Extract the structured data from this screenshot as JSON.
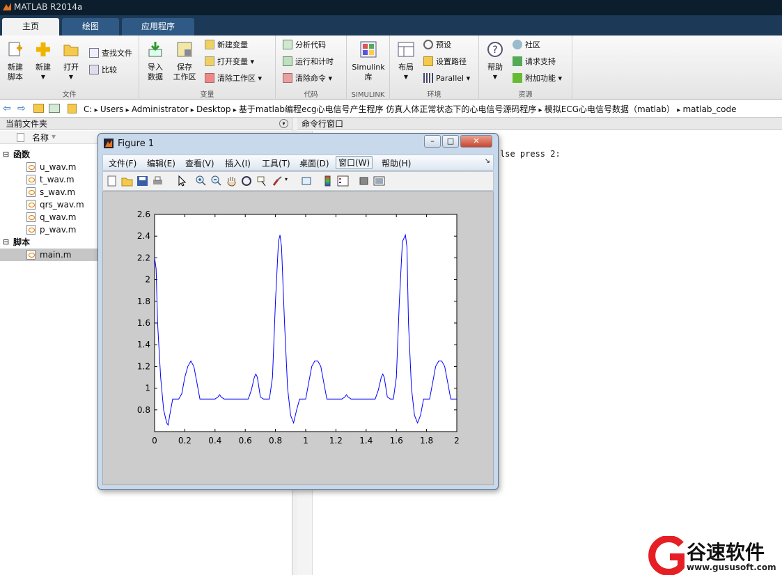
{
  "app": {
    "title": "MATLAB R2014a"
  },
  "tabs": [
    "主页",
    "绘图",
    "应用程序"
  ],
  "ribbon": {
    "file": {
      "label": "文件",
      "new_script": "新建\n脚本",
      "new": "新建",
      "open": "打开",
      "find_files": "查找文件",
      "compare": "比较"
    },
    "variable": {
      "label": "变量",
      "import": "导入\n数据",
      "save_ws": "保存\n工作区",
      "new_var": "新建变量",
      "open_var": "打开变量",
      "clear_ws": "清除工作区"
    },
    "code": {
      "label": "代码",
      "analyze": "分析代码",
      "run_time": "运行和计时",
      "clear_cmd": "清除命令"
    },
    "simulink": {
      "label": "SIMULINK",
      "lib": "Simulink\n库"
    },
    "env": {
      "label": "环境",
      "layout": "布局",
      "prefs": "预设",
      "set_path": "设置路径",
      "parallel": "Parallel"
    },
    "resources": {
      "label": "资源",
      "help": "帮助",
      "community": "社区",
      "request_support": "请求支持",
      "addons": "附加功能"
    }
  },
  "address": {
    "path": [
      "C:",
      "Users",
      "Administrator",
      "Desktop",
      "基于matlab编程ecg心电信号产生程序 仿真人体正常状态下的心电信号源码程序",
      "模拟ECG心电信号数据（matlab）",
      "matlab_code"
    ]
  },
  "current_folder": {
    "title": "当前文件夹",
    "column": "名称",
    "groups": [
      {
        "name": "函数",
        "files": [
          "u_wav.m",
          "t_wav.m",
          "s_wav.m",
          "qrs_wav.m",
          "q_wav.m",
          "p_wav.m"
        ]
      },
      {
        "name": "脚本",
        "files": [
          "main.m"
        ]
      }
    ]
  },
  "command_window": {
    "title": "命令行窗口",
    "text": "lse press 2:"
  },
  "figure": {
    "title": "Figure 1",
    "menu": [
      "文件(F)",
      "编辑(E)",
      "查看(V)",
      "插入(I)",
      "工具(T)",
      "桌面(D)",
      "窗口(W)",
      "帮助(H)"
    ]
  },
  "chart_data": {
    "type": "line",
    "xlim": [
      0,
      2
    ],
    "ylim": [
      0.6,
      2.6
    ],
    "xticks": [
      0,
      0.2,
      0.4,
      0.6,
      0.8,
      1,
      1.2,
      1.4,
      1.6,
      1.8,
      2
    ],
    "yticks": [
      0.8,
      1,
      1.2,
      1.4,
      1.6,
      1.8,
      2,
      2.2,
      2.4,
      2.6
    ],
    "xticklabels": [
      "0",
      "0.2",
      "0.4",
      "0.6",
      "0.8",
      "1",
      "1.2",
      "1.4",
      "1.6",
      "1.8",
      "2"
    ],
    "yticklabels": [
      "0.8",
      "1",
      "1.2",
      "1.4",
      "1.6",
      "1.8",
      "2",
      "2.2",
      "2.4",
      "2.6"
    ],
    "grid": false,
    "series": [
      {
        "color": "#0000ff",
        "x": [
          0,
          0.01,
          0.02,
          0.04,
          0.06,
          0.08,
          0.09,
          0.1,
          0.12,
          0.14,
          0.16,
          0.18,
          0.2,
          0.22,
          0.24,
          0.26,
          0.28,
          0.3,
          0.32,
          0.36,
          0.4,
          0.42,
          0.43,
          0.44,
          0.46,
          0.5,
          0.56,
          0.62,
          0.64,
          0.66,
          0.67,
          0.68,
          0.7,
          0.72,
          0.74,
          0.76,
          0.78,
          0.8,
          0.82,
          0.83,
          0.84,
          0.86,
          0.88,
          0.9,
          0.92,
          0.94,
          0.96,
          0.98,
          1.0,
          1.02,
          1.04,
          1.06,
          1.08,
          1.1,
          1.12,
          1.14,
          1.16,
          1.2,
          1.24,
          1.26,
          1.27,
          1.28,
          1.3,
          1.34,
          1.4,
          1.46,
          1.48,
          1.5,
          1.51,
          1.52,
          1.54,
          1.56,
          1.58,
          1.6,
          1.62,
          1.64,
          1.66,
          1.67,
          1.68,
          1.7,
          1.72,
          1.74,
          1.76,
          1.78,
          1.8,
          1.82,
          1.84,
          1.86,
          1.88,
          1.9,
          1.92,
          1.94,
          1.96,
          1.98,
          2.0
        ],
        "y": [
          2.2,
          2.1,
          1.6,
          1.1,
          0.8,
          0.68,
          0.66,
          0.75,
          0.9,
          0.9,
          0.9,
          0.95,
          1.1,
          1.2,
          1.25,
          1.2,
          1.05,
          0.9,
          0.9,
          0.9,
          0.9,
          0.92,
          0.94,
          0.92,
          0.9,
          0.9,
          0.9,
          0.9,
          0.98,
          1.1,
          1.13,
          1.1,
          0.92,
          0.9,
          0.9,
          0.9,
          1.1,
          1.8,
          2.35,
          2.41,
          2.3,
          1.6,
          1.0,
          0.75,
          0.68,
          0.8,
          0.9,
          0.9,
          0.9,
          1.05,
          1.2,
          1.25,
          1.25,
          1.2,
          1.05,
          0.9,
          0.9,
          0.9,
          0.9,
          0.92,
          0.94,
          0.92,
          0.9,
          0.9,
          0.9,
          0.9,
          0.98,
          1.1,
          1.13,
          1.1,
          0.92,
          0.9,
          0.9,
          1.1,
          1.8,
          2.35,
          2.41,
          2.3,
          1.6,
          1.0,
          0.75,
          0.68,
          0.75,
          0.9,
          0.9,
          0.9,
          1.05,
          1.2,
          1.25,
          1.25,
          1.2,
          1.05,
          0.9,
          0.9,
          0.9
        ]
      }
    ]
  },
  "watermark": {
    "name": "谷速软件",
    "url": "www.gususoft.com"
  }
}
